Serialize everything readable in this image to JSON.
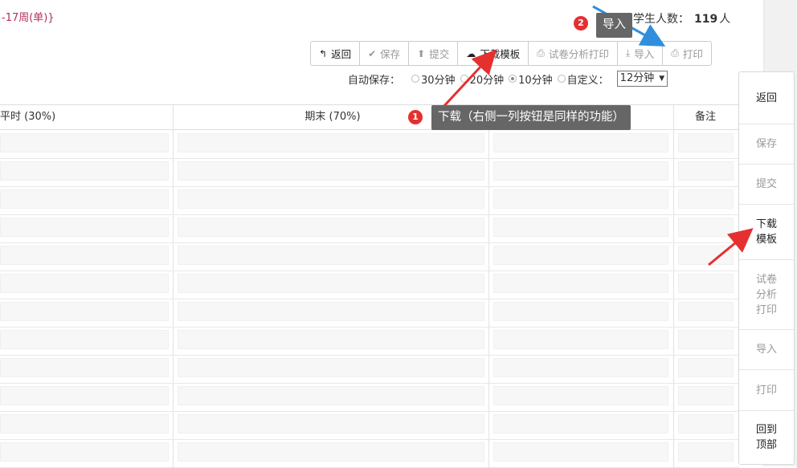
{
  "header": {
    "week_text": "-17周(单)}",
    "student_count_label": "学生人数：",
    "student_count_value": "119",
    "student_count_unit": "人"
  },
  "toolbar": {
    "buttons": [
      {
        "label": "返回",
        "icon": "back-arrow-icon"
      },
      {
        "label": "保存",
        "icon": "check-icon"
      },
      {
        "label": "提交",
        "icon": "upload-icon"
      },
      {
        "label": "下载模板",
        "icon": "cloud-download-icon"
      },
      {
        "label": "试卷分析打印",
        "icon": "print-icon"
      },
      {
        "label": "导入",
        "icon": "import-icon"
      },
      {
        "label": "打印",
        "icon": "print-icon"
      }
    ]
  },
  "autosave": {
    "label": "自动保存：",
    "options": [
      "30分钟",
      "20分钟",
      "10分钟",
      "自定义："
    ],
    "selected": "10分钟",
    "custom_value": "12分钟"
  },
  "table": {
    "headers": [
      "平时 (30%)",
      "期末 (70%)",
      "",
      "备注"
    ]
  },
  "sidebar": {
    "buttons": [
      {
        "label": "返回"
      },
      {
        "label": "保存"
      },
      {
        "label": "提交"
      },
      {
        "label": "下载\n模板"
      },
      {
        "label": "试卷\n分析\n打印"
      },
      {
        "label": "导入"
      },
      {
        "label": "打印"
      },
      {
        "label": "回到\n顶部"
      }
    ]
  },
  "annotations": {
    "callout1_number": "1",
    "callout1_text": "下载（右侧一列按钮是同样的功能）",
    "callout2_number": "2",
    "callout2_text": "导入",
    "accent_red": "#e53030",
    "accent_blue": "#2f8fdc"
  }
}
